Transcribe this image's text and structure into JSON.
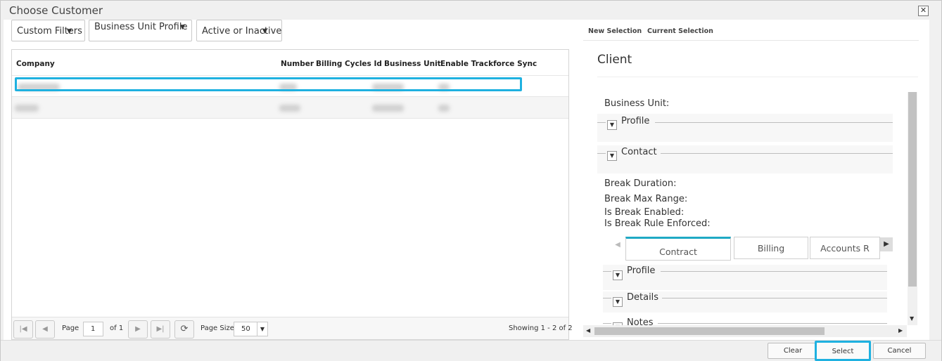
{
  "dialog": {
    "title": "Choose Customer",
    "close_glyph": "✕"
  },
  "filters": {
    "custom": "Custom Filters",
    "business_unit": "Business Unit Profile",
    "active": "Active or Inactive"
  },
  "grid": {
    "columns": [
      "Company",
      "Number",
      "Billing Cycles Id",
      "Business Unit",
      "Enable Trackforce Sync"
    ]
  },
  "pager": {
    "page_label": "Page",
    "page_value": "1",
    "of_label": "of 1",
    "page_size_label": "Page Size",
    "page_size_value": "50",
    "showing": "Showing 1 - 2 of 2"
  },
  "right": {
    "tabs": [
      "New Selection",
      "Current Selection"
    ],
    "heading": "Client",
    "business_unit_label": "Business Unit:",
    "groups": {
      "profile": "Profile",
      "contact": "Contact",
      "details": "Details",
      "notes": "Notes"
    },
    "break_duration": "Break Duration:",
    "break_max_range": "Break Max Range:",
    "is_break_enabled": "Is Break Enabled:",
    "is_break_rule_enforced": "Is Break Rule Enforced:",
    "subtabs": [
      "Contract",
      "Billing",
      "Accounts R"
    ]
  },
  "footer": {
    "clear": "Clear",
    "select": "Select",
    "cancel": "Cancel"
  },
  "colors": {
    "accent": "#1fb1e0",
    "tab_accent": "#1fa9c4"
  }
}
